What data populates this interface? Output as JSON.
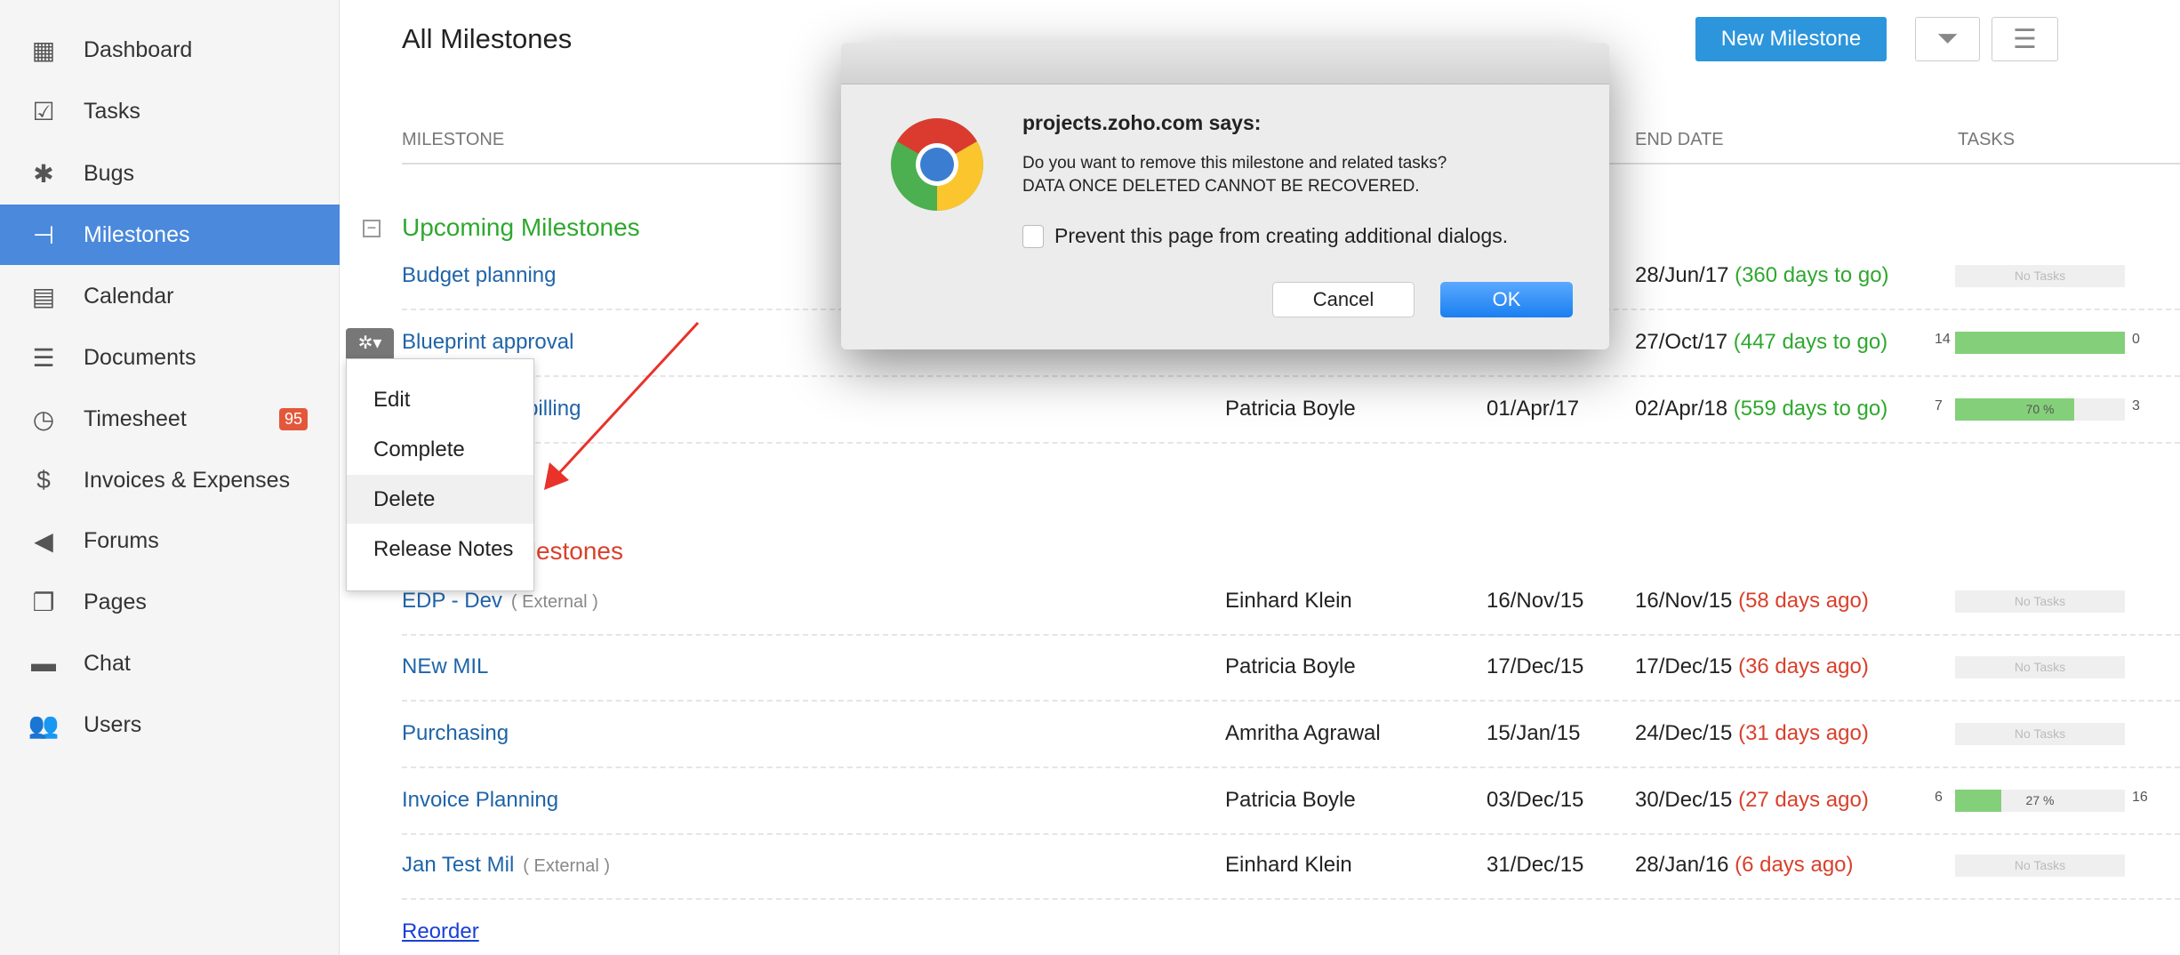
{
  "sidebar": {
    "items": [
      {
        "label": "Dashboard",
        "icon": "dashboard-icon",
        "glyph": "▦"
      },
      {
        "label": "Tasks",
        "icon": "tasks-icon",
        "glyph": "☑"
      },
      {
        "label": "Bugs",
        "icon": "bug-icon",
        "glyph": "✱"
      },
      {
        "label": "Milestones",
        "icon": "milestone-icon",
        "glyph": "⊣",
        "active": true
      },
      {
        "label": "Calendar",
        "icon": "calendar-icon",
        "glyph": "▤"
      },
      {
        "label": "Documents",
        "icon": "documents-icon",
        "glyph": "☰"
      },
      {
        "label": "Timesheet",
        "icon": "timer-icon",
        "glyph": "◷",
        "badge": "95"
      },
      {
        "label": "Invoices & Expenses",
        "icon": "invoice-icon",
        "glyph": "$"
      },
      {
        "label": "Forums",
        "icon": "megaphone-icon",
        "glyph": "◀"
      },
      {
        "label": "Pages",
        "icon": "pages-icon",
        "glyph": "❐"
      },
      {
        "label": "Chat",
        "icon": "chat-icon",
        "glyph": "▬"
      },
      {
        "label": "Users",
        "icon": "users-icon",
        "glyph": "👥"
      }
    ]
  },
  "header": {
    "title": "All Milestones",
    "new_button": "New Milestone"
  },
  "columns": {
    "milestone": "MILESTONE",
    "end_date": "END DATE",
    "tasks": "TASKS"
  },
  "upcoming": {
    "title": "Upcoming Milestones",
    "rows": [
      {
        "name": "Budget planning",
        "end": "28/Jun/17",
        "due": "(360 days to go)",
        "tasks": {
          "empty": "No Tasks"
        }
      },
      {
        "name": "Blueprint approval",
        "end": "27/Oct/17",
        "due": "(447 days to go)",
        "tasks": {
          "open": "14",
          "closed": "0",
          "percent": 100
        }
      },
      {
        "name": "Delivery and billing",
        "owner": "Patricia Boyle",
        "start": "01/Apr/17",
        "end": "02/Apr/18",
        "due": "(559 days to go)",
        "tasks": {
          "open": "7",
          "closed": "3",
          "percent": 70,
          "label": "70 %"
        }
      }
    ]
  },
  "overdue": {
    "title": "Overdue Milestones",
    "rows": [
      {
        "name": "EDP - Dev",
        "ext": "( External )",
        "owner": "Einhard Klein",
        "start": "16/Nov/15",
        "end": "16/Nov/15",
        "due": "(58 days ago)",
        "tasks": {
          "empty": "No Tasks"
        }
      },
      {
        "name": "NEw MIL",
        "owner": "Patricia Boyle",
        "start": "17/Dec/15",
        "end": "17/Dec/15",
        "due": "(36 days ago)",
        "tasks": {
          "empty": "No Tasks"
        }
      },
      {
        "name": "Purchasing",
        "owner": "Amritha Agrawal",
        "start": "15/Jan/15",
        "end": "24/Dec/15",
        "due": "(31 days ago)",
        "tasks": {
          "empty": "No Tasks"
        }
      },
      {
        "name": "Invoice Planning",
        "owner": "Patricia Boyle",
        "start": "03/Dec/15",
        "end": "30/Dec/15",
        "due": "(27 days ago)",
        "tasks": {
          "open": "6",
          "closed": "16",
          "percent": 27,
          "label": "27 %"
        }
      },
      {
        "name": "Jan Test Mil",
        "ext": "( External )",
        "owner": "Einhard Klein",
        "start": "31/Dec/15",
        "end": "28/Jan/16",
        "due": "(6 days ago)",
        "tasks": {
          "empty": "No Tasks"
        }
      }
    ]
  },
  "reorder": "Reorder",
  "context_menu": {
    "items": [
      "Edit",
      "Complete",
      "Delete",
      "Release Notes"
    ],
    "highlighted": "Delete"
  },
  "dialog": {
    "title": "projects.zoho.com says:",
    "message": "Do you want to remove this milestone and related tasks?",
    "warning": "DATA ONCE DELETED CANNOT BE RECOVERED.",
    "checkbox": "Prevent this page from creating additional dialogs.",
    "cancel": "Cancel",
    "ok": "OK"
  },
  "colors": {
    "accent": "#4a89dc",
    "upcoming": "#2ea82e",
    "overdue": "#d9402c",
    "progress": "#84d07a",
    "annotation_arrow": "#e8322a"
  }
}
